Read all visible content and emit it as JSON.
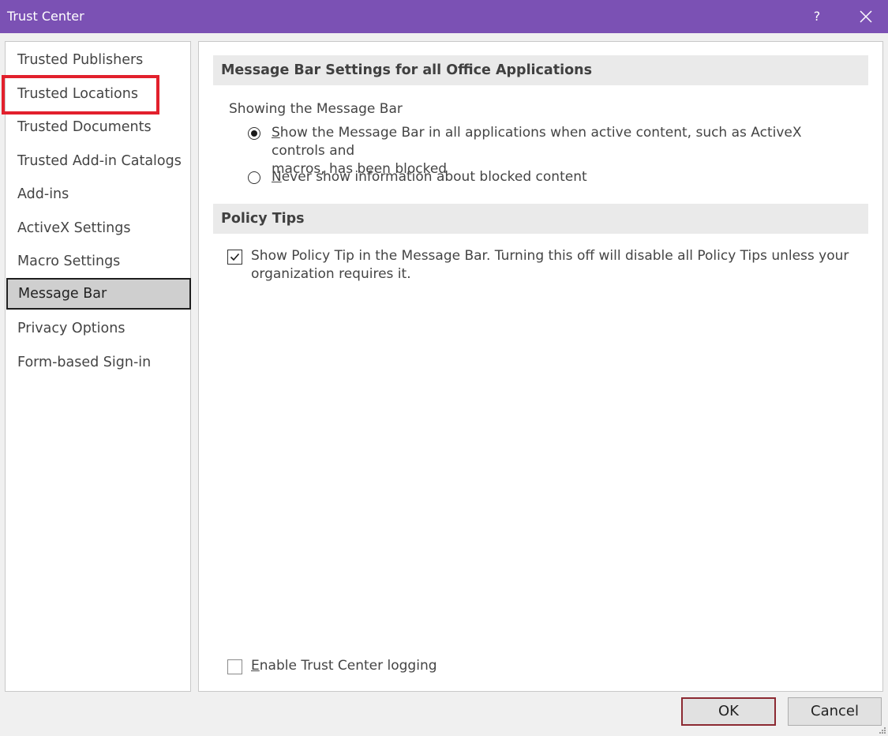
{
  "window": {
    "title": "Trust Center",
    "help_label": "?",
    "close_icon": "close-icon"
  },
  "sidebar": {
    "items": [
      {
        "label": "Trusted Publishers"
      },
      {
        "label": "Trusted Locations"
      },
      {
        "label": "Trusted Documents"
      },
      {
        "label": "Trusted Add-in Catalogs"
      },
      {
        "label": "Add-ins"
      },
      {
        "label": "ActiveX Settings"
      },
      {
        "label": "Macro Settings"
      },
      {
        "label": "Message Bar"
      },
      {
        "label": "Privacy Options"
      },
      {
        "label": "Form-based Sign-in"
      }
    ],
    "selected": "Message Bar",
    "highlighted": "Trusted Locations"
  },
  "main": {
    "message_bar_section": {
      "header": "Message Bar Settings for all Office Applications",
      "group_label": "Showing the Message Bar",
      "options": [
        {
          "accel": "S",
          "rest": "how the Message Bar in all applications when active content, such as ActiveX controls and",
          "line2": "macros, has been blocked",
          "checked": true
        },
        {
          "accel": "N",
          "rest": "ever show information about blocked content",
          "checked": false
        }
      ]
    },
    "policy_tips_section": {
      "header": "Policy Tips",
      "checkbox_line1": "Show Policy Tip in the Message Bar. Turning this off will disable all Policy Tips unless your",
      "checkbox_line2": "organization requires it.",
      "checked": true
    },
    "logging": {
      "accel": "E",
      "rest": "nable Trust Center logging",
      "checked": false
    }
  },
  "footer": {
    "ok_label": "OK",
    "cancel_label": "Cancel"
  },
  "colors": {
    "titlebar": "#7b51b4",
    "annotation_red": "#e2202c",
    "ok_border": "#8c2a32",
    "selected_bg": "#cfcfcf"
  }
}
